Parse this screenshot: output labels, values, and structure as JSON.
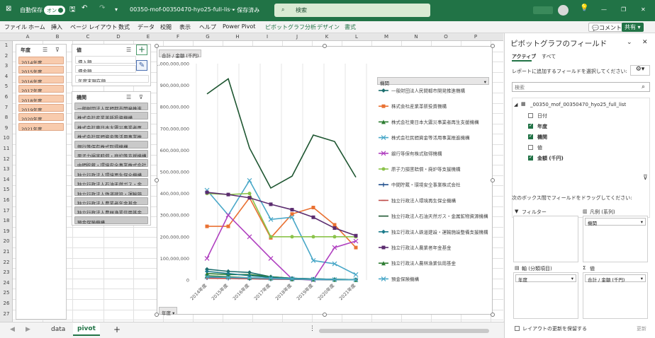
{
  "titlebar": {
    "autosave": "自動保存",
    "autosave_state": "オン",
    "filename": "00350-mof-00350470-hyo25-full-lis···",
    "saved": "• 保存済み",
    "search_placeholder": "検索"
  },
  "menu": {
    "items": [
      "ファイル",
      "ホーム",
      "挿入",
      "ページ レイアウト",
      "数式",
      "データ",
      "校閲",
      "表示",
      "ヘルプ",
      "Power Pivot",
      "ピボットグラフ分析",
      "デザイン",
      "書式"
    ],
    "comment": "コメント",
    "share": "共有"
  },
  "columns": [
    "A",
    "B",
    "C",
    "D",
    "E",
    "F",
    "G",
    "H",
    "I",
    "J",
    "K",
    "L",
    "M",
    "N",
    "O",
    "P"
  ],
  "rows": [
    "1",
    "2",
    "3",
    "4",
    "5",
    "6",
    "7",
    "8",
    "9",
    "10",
    "11",
    "12",
    "13",
    "14",
    "15",
    "16",
    "17",
    "18",
    "19",
    "20",
    "21",
    "22",
    "23",
    "24",
    "25",
    "26",
    "27"
  ],
  "slicer_year": {
    "header": "年度",
    "items": [
      "2014年度",
      "2015年度",
      "2016年度",
      "2017年度",
      "2018年度",
      "2019年度",
      "2020年度",
      "2021年度"
    ]
  },
  "slicer_value": {
    "header": "値",
    "items": [
      "債入額",
      "債金額",
      "年度末現在額"
    ]
  },
  "slicer_org": {
    "header": "機関",
    "items": [
      "一般財団法人民間都市開発推進...",
      "株式会社産業革新投資機構",
      "株式会社東日本大震災事業者再...",
      "株式会社民間資金等活用事業推...",
      "銀行等保有株式取得機構",
      "原子力損害賠償・廃炉等支援機構",
      "中間貯蔵・環境安全事業株式会社",
      "独立行政法人環境再生保全機構",
      "独立行政法人石油天然ガス・金...",
      "独立行政法人鉄道建設・運輸施...",
      "独立行政法人農業者年金基金",
      "独立行政法人農林漁業信用基金",
      "預金保険機構"
    ]
  },
  "chart": {
    "value_button": "合計 / 金額 (千円)",
    "axis_button": "年度",
    "legend_button": "機関"
  },
  "chart_data": {
    "type": "line",
    "categories": [
      "2014年度",
      "2015年度",
      "2016年度",
      "2017年度",
      "2018年度",
      "2019年度",
      "2020年度",
      "2021年度"
    ],
    "ylim": [
      0,
      1000000000
    ],
    "yticks": [
      "0",
      "100,000,000",
      "200,000,000",
      "300,000,000",
      "400,000,000",
      "500,000,000",
      "600,000,000",
      "700,000,000",
      "800,000,000",
      "900,000,000",
      "1,000,000,000"
    ],
    "series": [
      {
        "name": "一般財団法人民間都市開発推進機構",
        "color": "#1b6e6e",
        "marker": "diamond",
        "values": [
          50000000,
          40000000,
          35000000,
          15000000,
          8000000,
          5000000,
          3000000,
          2000000
        ]
      },
      {
        "name": "株式会社産業革新投資機構",
        "color": "#e97132",
        "marker": "square",
        "values": [
          248000000,
          248000000,
          380000000,
          195000000,
          305000000,
          335000000,
          255000000,
          150000000
        ]
      },
      {
        "name": "株式会社東日本大震災事業者再生支援機構",
        "color": "#2e7d32",
        "marker": "triangle",
        "values": [
          30000000,
          25000000,
          25000000,
          15000000,
          8000000,
          5000000,
          3000000,
          2000000
        ]
      },
      {
        "name": "株式会社民間資金等活用事業推進機構",
        "color": "#4aa8c8",
        "marker": "x",
        "values": [
          415000000,
          300000000,
          460000000,
          280000000,
          290000000,
          90000000,
          75000000,
          25000000
        ]
      },
      {
        "name": "銀行等保有株式取得機構",
        "color": "#b040c0",
        "marker": "x",
        "values": [
          100000000,
          300000000,
          200000000,
          100000000,
          5000000,
          0,
          150000000,
          180000000
        ]
      },
      {
        "name": "原子力損害賠償・廃炉等支援機構",
        "color": "#8bc34a",
        "marker": "circle",
        "values": [
          400000000,
          395000000,
          400000000,
          200000000,
          200000000,
          200000000,
          200000000,
          200000000
        ]
      },
      {
        "name": "中間貯蔵・環境安全事業株式会社",
        "color": "#1f4e8c",
        "marker": "plus",
        "values": [
          10000000,
          8000000,
          6000000,
          4000000,
          3000000,
          2000000,
          1000000,
          1000000
        ]
      },
      {
        "name": "独立行政法人環境再生保全機構",
        "color": "#c0504d",
        "marker": "dash",
        "values": [
          8000000,
          7000000,
          6000000,
          5000000,
          4000000,
          3000000,
          2000000,
          2000000
        ]
      },
      {
        "name": "独立行政法人石油天然ガス・金属鉱物資源機構",
        "color": "#1e5631",
        "marker": "none",
        "values": [
          860000000,
          930000000,
          610000000,
          425000000,
          480000000,
          670000000,
          640000000,
          475000000
        ]
      },
      {
        "name": "独立行政法人鉄道建設・運輸施設整備支援機構",
        "color": "#1a7a8a",
        "marker": "diamond",
        "values": [
          40000000,
          30000000,
          20000000,
          12000000,
          8000000,
          5000000,
          3000000,
          2000000
        ]
      },
      {
        "name": "独立行政法人農業者年金基金",
        "color": "#5b2c6f",
        "marker": "square",
        "values": [
          405000000,
          395000000,
          380000000,
          350000000,
          325000000,
          290000000,
          240000000,
          205000000
        ]
      },
      {
        "name": "独立行政法人農林漁業信用基金",
        "color": "#2e7d32",
        "marker": "triangle",
        "values": [
          20000000,
          15000000,
          10000000,
          8000000,
          5000000,
          3000000,
          2000000,
          1000000
        ]
      },
      {
        "name": "預金保険機構",
        "color": "#4aa8c8",
        "marker": "x",
        "values": [
          15000000,
          12000000,
          10000000,
          8000000,
          5000000,
          3000000,
          2000000,
          1000000
        ]
      }
    ]
  },
  "pane": {
    "title": "ピボットグラフのフィールド",
    "tab_active": "アクティブ",
    "tab_all": "すべて",
    "choose_label": "レポートに追加するフィールドを選択してください:",
    "search_placeholder": "検索",
    "table_name": "_00350_mof_00350470_hyo25_full_list",
    "fields": [
      {
        "label": "日付",
        "checked": false,
        "bold": false
      },
      {
        "label": "年度",
        "checked": true,
        "bold": true
      },
      {
        "label": "機関",
        "checked": true,
        "bold": true
      },
      {
        "label": "値",
        "checked": false,
        "bold": false
      },
      {
        "label": "金額 (千円)",
        "checked": true,
        "bold": true
      }
    ],
    "drag_label": "次のボックス間でフィールドをドラッグしてください:",
    "filter_label": "フィルター",
    "legend_label": "凡例 (系列)",
    "legend_item": "機関",
    "axis_label": "軸 (分類項目)",
    "axis_item": "年度",
    "values_label": "値",
    "values_item": "合計 / 金額 (千円)",
    "defer_label": "レイアウトの更新を保留する",
    "update_label": "更新"
  },
  "tabs": {
    "items": [
      "data",
      "pivot"
    ],
    "active": "pivot"
  }
}
